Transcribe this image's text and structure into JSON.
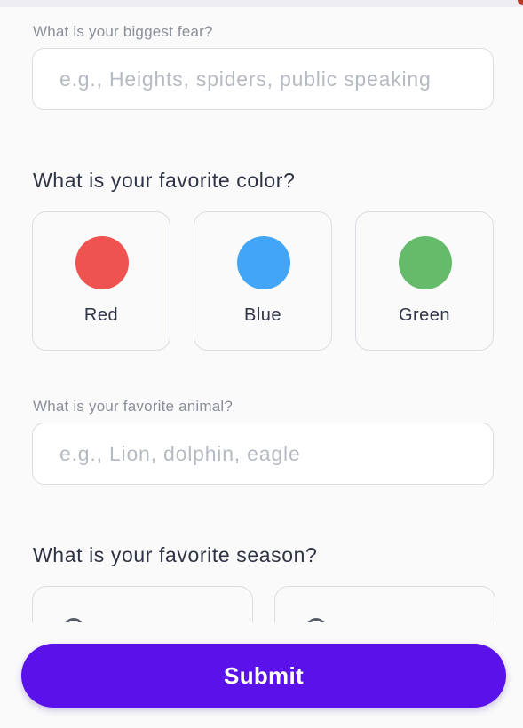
{
  "fear": {
    "label": "What is your biggest fear?",
    "value": "",
    "placeholder": "e.g., Heights, spiders, public speaking"
  },
  "color_question": {
    "title": "What is your favorite color?",
    "options": [
      {
        "label": "Red",
        "swatch": "#ef5350"
      },
      {
        "label": "Blue",
        "swatch": "#42a5f5"
      },
      {
        "label": "Green",
        "swatch": "#66bb6a"
      }
    ]
  },
  "animal": {
    "label": "What is your favorite animal?",
    "value": "",
    "placeholder": "e.g., Lion, dolphin, eagle"
  },
  "season_question": {
    "title": "What is your favorite season?",
    "options": [
      {
        "icon": "season-icon"
      },
      {
        "icon": "season-icon"
      }
    ]
  },
  "submit": {
    "label": "Submit",
    "color": "#5b12ea"
  }
}
